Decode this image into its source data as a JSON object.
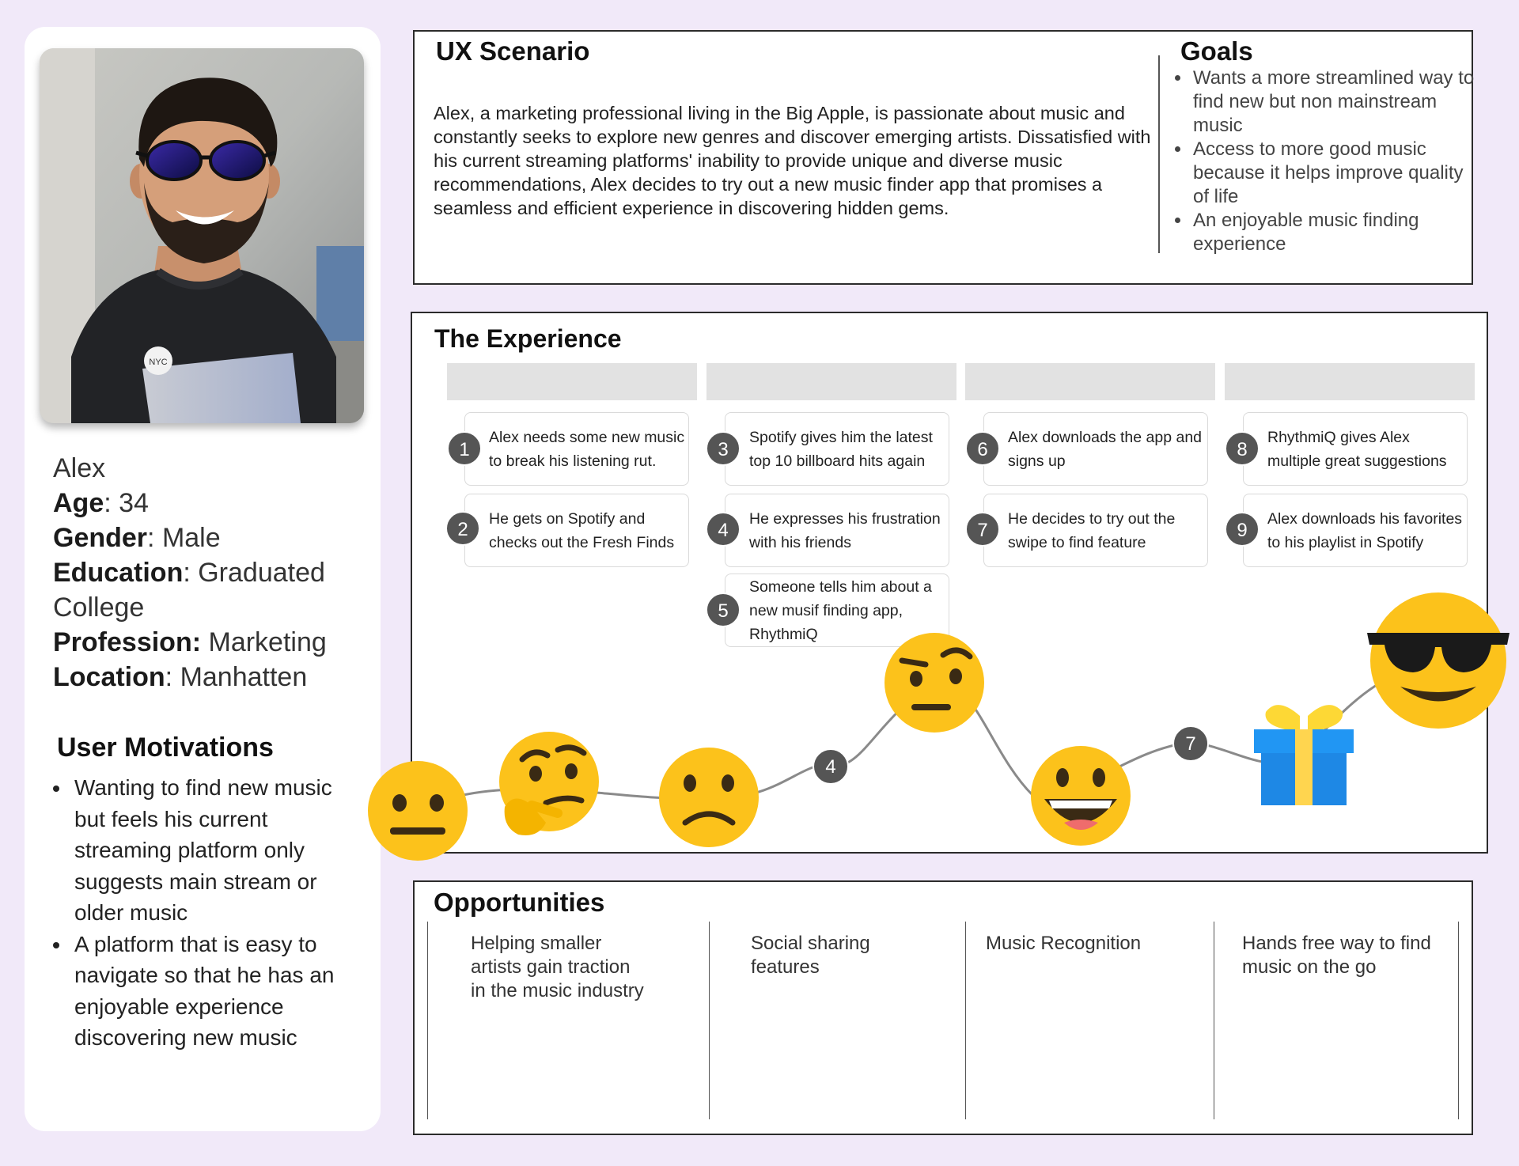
{
  "persona": {
    "name": "Alex",
    "age_label": "Age",
    "age": ": 34",
    "gender_label": "Gender",
    "gender": ":  Male",
    "education_label": "Education",
    "education_1": ": Graduated",
    "education_2": "College",
    "profession_label": "Profession:",
    "profession": " Marketing",
    "location_label": "Location",
    "location": ": Manhatten",
    "motivations_title": "User Motivations",
    "motivations": [
      "Wanting to find new music but feels his current streaming platform only suggests main stream or older music",
      "A platform that is easy to navigate so that he has an enjoyable experience discovering new music"
    ],
    "shirt_badge": "NYC"
  },
  "scenario": {
    "title": "UX Scenario",
    "text": "Alex, a marketing professional living in the Big Apple, is passionate about music and constantly seeks to explore new genres and discover emerging artists. Dissatisfied with his current streaming platforms' inability to provide unique and diverse music recommendations, Alex decides to try out a new music finder app that promises a seamless and efficient experience in discovering hidden gems.",
    "goals_title": "Goals",
    "goals": [
      "Wants a more streamlined way to find new but non mainstream music",
      "Access to more good music because it helps improve quality of life",
      "An enjoyable music finding experience"
    ]
  },
  "experience": {
    "title": "The Experience",
    "steps": [
      {
        "num": "1",
        "text": "Alex needs some new music to break his listening rut."
      },
      {
        "num": "2",
        "text": "He gets on Spotify and checks out the Fresh Finds"
      },
      {
        "num": "3",
        "text": "Spotify gives him the latest top 10 billboard hits again"
      },
      {
        "num": "4",
        "text": "He expresses his frustration with his friends"
      },
      {
        "num": "5",
        "text": "Someone tells him about a new musif finding app, RhythmiQ"
      },
      {
        "num": "6",
        "text": "Alex downloads the app and signs up"
      },
      {
        "num": "7",
        "text": "He decides to try out the swipe to find feature"
      },
      {
        "num": "8",
        "text": "RhythmiQ gives Alex multiple great suggestions"
      },
      {
        "num": "9",
        "text": "Alex downloads his favorites to his playlist in Spotify"
      }
    ],
    "curve_labels": {
      "a": "4",
      "b": "7"
    },
    "emojis": [
      "neutral-face",
      "thinking-face",
      "frowning-face",
      "raised-eyebrow-face",
      "grinning-face",
      "gift",
      "sunglasses-face"
    ],
    "colors": {
      "emoji_yellow": "#fcc21b",
      "badge": "#555555",
      "gift_blue": "#2196f3",
      "ribbon": "#ffd54f"
    }
  },
  "opportunities": {
    "title": "Opportunities",
    "items": [
      "Helping smaller artists gain traction in the music industry",
      "Social sharing features",
      "Music Recognition",
      "Hands free way to find music on the go"
    ]
  }
}
